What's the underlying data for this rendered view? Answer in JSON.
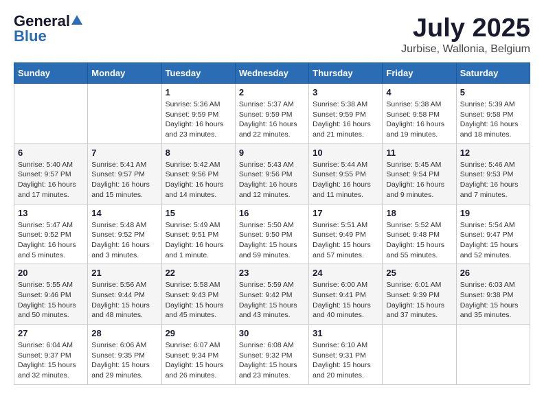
{
  "header": {
    "logo_general": "General",
    "logo_blue": "Blue",
    "month": "July 2025",
    "location": "Jurbise, Wallonia, Belgium"
  },
  "weekdays": [
    "Sunday",
    "Monday",
    "Tuesday",
    "Wednesday",
    "Thursday",
    "Friday",
    "Saturday"
  ],
  "weeks": [
    [
      {
        "day": "",
        "info": ""
      },
      {
        "day": "",
        "info": ""
      },
      {
        "day": "1",
        "info": "Sunrise: 5:36 AM\nSunset: 9:59 PM\nDaylight: 16 hours and 23 minutes."
      },
      {
        "day": "2",
        "info": "Sunrise: 5:37 AM\nSunset: 9:59 PM\nDaylight: 16 hours and 22 minutes."
      },
      {
        "day": "3",
        "info": "Sunrise: 5:38 AM\nSunset: 9:59 PM\nDaylight: 16 hours and 21 minutes."
      },
      {
        "day": "4",
        "info": "Sunrise: 5:38 AM\nSunset: 9:58 PM\nDaylight: 16 hours and 19 minutes."
      },
      {
        "day": "5",
        "info": "Sunrise: 5:39 AM\nSunset: 9:58 PM\nDaylight: 16 hours and 18 minutes."
      }
    ],
    [
      {
        "day": "6",
        "info": "Sunrise: 5:40 AM\nSunset: 9:57 PM\nDaylight: 16 hours and 17 minutes."
      },
      {
        "day": "7",
        "info": "Sunrise: 5:41 AM\nSunset: 9:57 PM\nDaylight: 16 hours and 15 minutes."
      },
      {
        "day": "8",
        "info": "Sunrise: 5:42 AM\nSunset: 9:56 PM\nDaylight: 16 hours and 14 minutes."
      },
      {
        "day": "9",
        "info": "Sunrise: 5:43 AM\nSunset: 9:56 PM\nDaylight: 16 hours and 12 minutes."
      },
      {
        "day": "10",
        "info": "Sunrise: 5:44 AM\nSunset: 9:55 PM\nDaylight: 16 hours and 11 minutes."
      },
      {
        "day": "11",
        "info": "Sunrise: 5:45 AM\nSunset: 9:54 PM\nDaylight: 16 hours and 9 minutes."
      },
      {
        "day": "12",
        "info": "Sunrise: 5:46 AM\nSunset: 9:53 PM\nDaylight: 16 hours and 7 minutes."
      }
    ],
    [
      {
        "day": "13",
        "info": "Sunrise: 5:47 AM\nSunset: 9:52 PM\nDaylight: 16 hours and 5 minutes."
      },
      {
        "day": "14",
        "info": "Sunrise: 5:48 AM\nSunset: 9:52 PM\nDaylight: 16 hours and 3 minutes."
      },
      {
        "day": "15",
        "info": "Sunrise: 5:49 AM\nSunset: 9:51 PM\nDaylight: 16 hours and 1 minute."
      },
      {
        "day": "16",
        "info": "Sunrise: 5:50 AM\nSunset: 9:50 PM\nDaylight: 15 hours and 59 minutes."
      },
      {
        "day": "17",
        "info": "Sunrise: 5:51 AM\nSunset: 9:49 PM\nDaylight: 15 hours and 57 minutes."
      },
      {
        "day": "18",
        "info": "Sunrise: 5:52 AM\nSunset: 9:48 PM\nDaylight: 15 hours and 55 minutes."
      },
      {
        "day": "19",
        "info": "Sunrise: 5:54 AM\nSunset: 9:47 PM\nDaylight: 15 hours and 52 minutes."
      }
    ],
    [
      {
        "day": "20",
        "info": "Sunrise: 5:55 AM\nSunset: 9:46 PM\nDaylight: 15 hours and 50 minutes."
      },
      {
        "day": "21",
        "info": "Sunrise: 5:56 AM\nSunset: 9:44 PM\nDaylight: 15 hours and 48 minutes."
      },
      {
        "day": "22",
        "info": "Sunrise: 5:58 AM\nSunset: 9:43 PM\nDaylight: 15 hours and 45 minutes."
      },
      {
        "day": "23",
        "info": "Sunrise: 5:59 AM\nSunset: 9:42 PM\nDaylight: 15 hours and 43 minutes."
      },
      {
        "day": "24",
        "info": "Sunrise: 6:00 AM\nSunset: 9:41 PM\nDaylight: 15 hours and 40 minutes."
      },
      {
        "day": "25",
        "info": "Sunrise: 6:01 AM\nSunset: 9:39 PM\nDaylight: 15 hours and 37 minutes."
      },
      {
        "day": "26",
        "info": "Sunrise: 6:03 AM\nSunset: 9:38 PM\nDaylight: 15 hours and 35 minutes."
      }
    ],
    [
      {
        "day": "27",
        "info": "Sunrise: 6:04 AM\nSunset: 9:37 PM\nDaylight: 15 hours and 32 minutes."
      },
      {
        "day": "28",
        "info": "Sunrise: 6:06 AM\nSunset: 9:35 PM\nDaylight: 15 hours and 29 minutes."
      },
      {
        "day": "29",
        "info": "Sunrise: 6:07 AM\nSunset: 9:34 PM\nDaylight: 15 hours and 26 minutes."
      },
      {
        "day": "30",
        "info": "Sunrise: 6:08 AM\nSunset: 9:32 PM\nDaylight: 15 hours and 23 minutes."
      },
      {
        "day": "31",
        "info": "Sunrise: 6:10 AM\nSunset: 9:31 PM\nDaylight: 15 hours and 20 minutes."
      },
      {
        "day": "",
        "info": ""
      },
      {
        "day": "",
        "info": ""
      }
    ]
  ]
}
